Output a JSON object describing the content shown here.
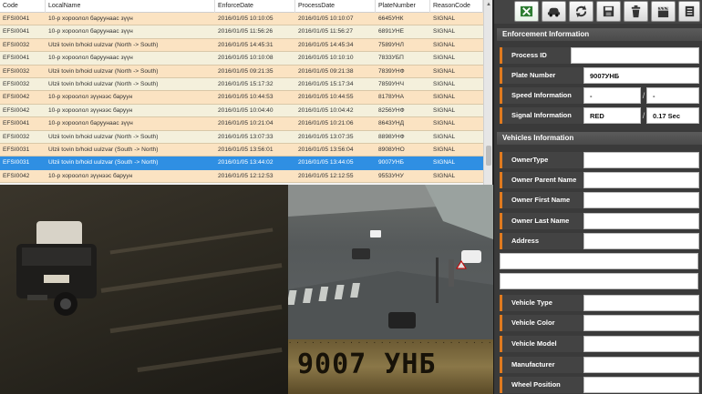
{
  "table": {
    "headers": [
      "Code",
      "LocalName",
      "EnforceDate",
      "ProcessDate",
      "PlateNumber",
      "ReasonCode"
    ],
    "rows": [
      [
        "EFSI0041",
        "10-р хороолол баруунаас зүүн",
        "2016/01/05 10:10:05",
        "2016/01/05 10:10:07",
        "6645УНК",
        "SIGNAL"
      ],
      [
        "EFSI0041",
        "10-р хороолол баруунаас зүүн",
        "2016/01/05 11:56:26",
        "2016/01/05 11:56:27",
        "6891УНЕ",
        "SIGNAL"
      ],
      [
        "EFSI0032",
        "Ulzii tovin b/hoid uulzvar (North -> South)",
        "2016/01/05 14:45:31",
        "2016/01/05 14:45:34",
        "7589УНЛ",
        "SIGNAL"
      ],
      [
        "EFSI0041",
        "10-р хороолол баруунаас зүүн",
        "2016/01/05 10:10:08",
        "2016/01/05 10:10:10",
        "7833УБП",
        "SIGNAL"
      ],
      [
        "EFSI0032",
        "Ulzii tovin b/hoid uulzvar (North -> South)",
        "2016/01/05 09:21:35",
        "2016/01/05 09:21:38",
        "7839УНФ",
        "SIGNAL"
      ],
      [
        "EFSI0032",
        "Ulzii tovin b/hoid uulzvar (North -> South)",
        "2016/01/05 15:17:32",
        "2016/01/05 15:17:34",
        "7859УНЧ",
        "SIGNAL"
      ],
      [
        "EFSI0042",
        "10-р хороолол зүүнээс баруун",
        "2016/01/05 10:44:53",
        "2016/01/05 10:44:55",
        "8178УНА",
        "SIGNAL"
      ],
      [
        "EFSI0042",
        "10-р хороолол зүүнээс баруун",
        "2016/01/05 10:04:40",
        "2016/01/05 10:04:42",
        "8256УНФ",
        "SIGNAL"
      ],
      [
        "EFSI0041",
        "10-р хороолол баруунаас зүүн",
        "2016/01/05 10:21:04",
        "2016/01/05 10:21:06",
        "8643УНД",
        "SIGNAL"
      ],
      [
        "EFSI0032",
        "Ulzii tovin b/hoid uulzvar (North -> South)",
        "2016/01/05 13:07:33",
        "2016/01/05 13:07:35",
        "8898УНФ",
        "SIGNAL"
      ],
      [
        "EFSI0031",
        "Ulzii tovin b/hoid uulzvar (South -> North)",
        "2016/01/05 13:56:01",
        "2016/01/05 13:56:04",
        "8908УНО",
        "SIGNAL"
      ],
      [
        "EFSI0031",
        "Ulzii tovin b/hoid uulzvar (South -> North)",
        "2016/01/05 13:44:02",
        "2016/01/05 13:44:05",
        "9007УНБ",
        "SIGNAL"
      ],
      [
        "EFSI0042",
        "10-р хороолол зүүнээс баруун",
        "2016/01/05 12:12:53",
        "2016/01/05 12:12:55",
        "9553УНУ",
        "SIGNAL"
      ]
    ],
    "selected_index": 11
  },
  "plate_crop": {
    "text": "9007 УНБ",
    "top_text": "· · · · · · · · · · · · · · · · · · · · · · · · · · · · ·"
  },
  "toolbar": {
    "icons": [
      "excel-icon",
      "car-icon",
      "refresh-icon",
      "save-icon",
      "trash-icon",
      "clapperboard-icon",
      "list-icon"
    ]
  },
  "enforcement": {
    "title": "Enforcement Information",
    "process_id_label": "Process ID",
    "process_id_value": "",
    "plate_label": "Plate Number",
    "plate_value": "9007УНБ",
    "speed_label": "Speed Information",
    "speed_value_1": "-",
    "speed_value_2": "-",
    "signal_label": "Signal Information",
    "signal_value_1": "RED",
    "signal_value_2": "0.17 Sec"
  },
  "vehicles": {
    "title": "Vehicles Information",
    "owner_type_label": "OwnerType",
    "owner_parent_label": "Owner Parent Name",
    "owner_first_label": "Owner First Name",
    "owner_last_label": "Owner Last Name",
    "address_label": "Address",
    "vehicle_type_label": "Vehicle Type",
    "vehicle_color_label": "Vehicle Color",
    "vehicle_model_label": "Vehicle Model",
    "manufacturer_label": "Manufacturer",
    "wheel_position_label": "Wheel Position"
  },
  "colors": {
    "accent": "#e07a1f",
    "row_odd": "#fbe3c2",
    "row_even": "#f4f0dc",
    "selected": "#2f8fe3",
    "panel": "#3a3a3a"
  }
}
